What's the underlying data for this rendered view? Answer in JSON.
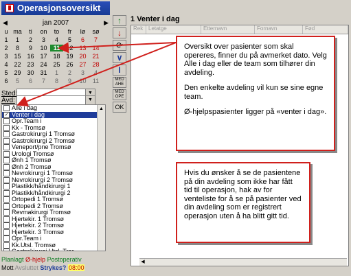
{
  "window": {
    "title": "Operasjonsoversikt"
  },
  "calendar": {
    "prev": "◀",
    "next": "▶",
    "month": "jan 2007",
    "weekday_header": [
      "u",
      "ma",
      "ti",
      "on",
      "to",
      "fr",
      "lø",
      "sø"
    ],
    "weeks": [
      {
        "wk": "1",
        "days": [
          "1",
          "2",
          "3",
          "4",
          "5",
          "6",
          "7"
        ]
      },
      {
        "wk": "2",
        "days": [
          "8",
          "9",
          "10",
          "11",
          "12",
          "13",
          "14"
        ]
      },
      {
        "wk": "3",
        "days": [
          "15",
          "16",
          "17",
          "18",
          "19",
          "20",
          "21"
        ]
      },
      {
        "wk": "4",
        "days": [
          "22",
          "23",
          "24",
          "25",
          "26",
          "27",
          "28"
        ]
      },
      {
        "wk": "5",
        "days": [
          "29",
          "30",
          "31",
          "1",
          "2",
          "3",
          "4"
        ]
      },
      {
        "wk": "6",
        "days": [
          "5",
          "6",
          "7",
          "8",
          "9",
          "10",
          "11"
        ]
      }
    ],
    "selected_day": "11"
  },
  "sted": {
    "label": "Sted:",
    "value": ""
  },
  "avd": {
    "label": "Avd:",
    "value": ""
  },
  "department_list": [
    {
      "label": "Alle i dag",
      "checked": false,
      "selected": false
    },
    {
      "label": "Venter i dag",
      "checked": true,
      "selected": true
    },
    {
      "label": "Opr.Team i",
      "checked": false,
      "selected": false
    },
    {
      "label": "Kk - Tromsø",
      "checked": false,
      "selected": false
    },
    {
      "label": "Gastrokirurgi 1 Tromsø",
      "checked": false,
      "selected": false
    },
    {
      "label": "Gastrokirurgi 2 Tromsø",
      "checked": false,
      "selected": false
    },
    {
      "label": "Veneport/pne Tromsø",
      "checked": false,
      "selected": false
    },
    {
      "label": "Urologi Tromsø",
      "checked": false,
      "selected": false
    },
    {
      "label": "Ønh 1 Tromsø",
      "checked": false,
      "selected": false
    },
    {
      "label": "Ønh 2 Tromsø",
      "checked": false,
      "selected": false
    },
    {
      "label": "Nevrokirurgi 1 Tromsø",
      "checked": false,
      "selected": false
    },
    {
      "label": "Nevrokirurgi 2 Tromsø",
      "checked": false,
      "selected": false
    },
    {
      "label": "Plastikk/håndkirurgi 1",
      "checked": false,
      "selected": false
    },
    {
      "label": "Plastikk/håndkirurgi 2",
      "checked": false,
      "selected": false
    },
    {
      "label": "Ortopedi 1 Tromsø",
      "checked": false,
      "selected": false
    },
    {
      "label": "Ortopedi 2 Tromsø",
      "checked": false,
      "selected": false
    },
    {
      "label": "Revmakirurgi Tromsø",
      "checked": false,
      "selected": false
    },
    {
      "label": "Hjertekir. 1 Tromsø",
      "checked": false,
      "selected": false
    },
    {
      "label": "Hjertekir. 2 Tromsø",
      "checked": false,
      "selected": false
    },
    {
      "label": "Hjertekir. 3 Tromsø",
      "checked": false,
      "selected": false
    },
    {
      "label": "Opr.Team i",
      "checked": false,
      "selected": false
    },
    {
      "label": "Kk.Utsl. Tromsø",
      "checked": false,
      "selected": false
    },
    {
      "label": "Gastrokirurgi Utsl. Tror",
      "checked": false,
      "selected": false
    },
    {
      "label": "Urologi Utsl Tromsø",
      "checked": false,
      "selected": false
    },
    {
      "label": "Barn/annet Utsl Trom",
      "checked": false,
      "selected": false
    }
  ],
  "legend": {
    "planlagt": "Planlagt",
    "ohjelp": "Ø-hjelp",
    "postoperativ": "Postoperativ",
    "mott": "Mott",
    "avsluttet": "Avsluttet",
    "strykes": "Strykes?",
    "time": "08:00"
  },
  "toolbar": {
    "up": "↑",
    "down": "↓",
    "refresh": "⟳",
    "expand": "∨",
    "info": "I",
    "med_ahe": "MED AHE",
    "med_ope": "MED OPE",
    "ok": "OK"
  },
  "panel": {
    "number": "1",
    "title": "Venter i dag",
    "columns": [
      "Rek",
      "Letatge",
      "Etternavn",
      "Fornavn",
      "Fød"
    ]
  },
  "note1": {
    "p1": "Oversikt over pasienter som skal opereres, finner du på avmerket dato. Velg Alle i dag eller de team som tilhører din avdeling.",
    "p2": "Den enkelte avdeling vil kun se sine egne team.",
    "p3": "Ø-hjelpspasienter ligger på «venter i dag»."
  },
  "note2": {
    "p1": "Hvis du ønsker å se de pasientene på din avdeling som ikke har fått tid til operasjon, hak av for venteliste for å se på pasienter ved din avdeling som er registrert operasjon uten å ha blitt gitt tid."
  },
  "colors": {
    "accent_red": "#d0201c",
    "title_blue": "#1f3c9a",
    "today_green": "#1e8a2e"
  }
}
